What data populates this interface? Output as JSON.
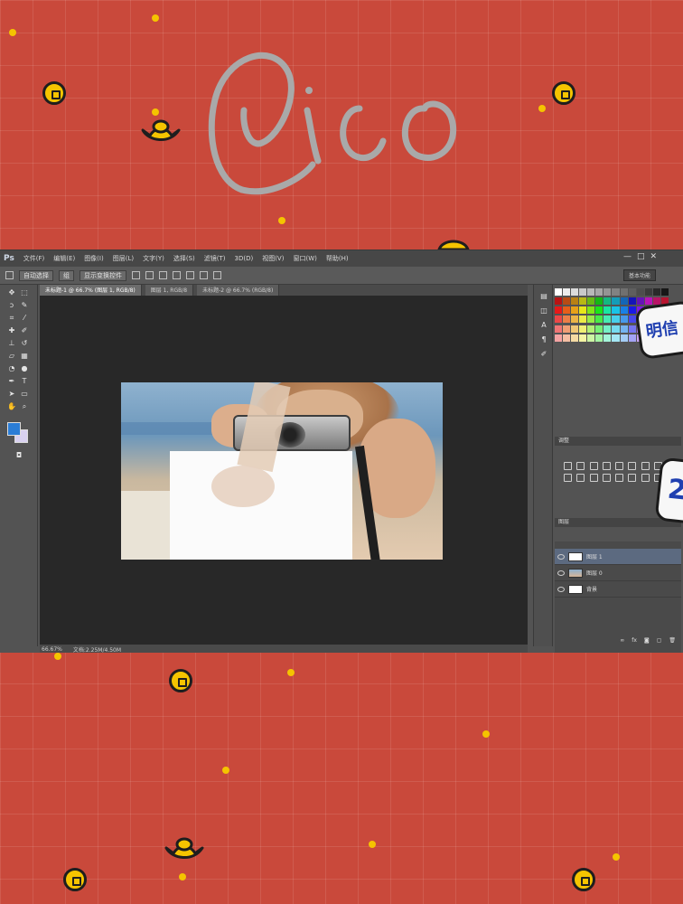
{
  "signature": "Pico",
  "photoshop": {
    "logo": "Ps",
    "menu": [
      "文件(F)",
      "编辑(E)",
      "图像(I)",
      "图层(L)",
      "文字(Y)",
      "选择(S)",
      "滤镜(T)",
      "3D(D)",
      "视图(V)",
      "窗口(W)",
      "帮助(H)"
    ],
    "window_controls": [
      "—",
      "□",
      "✕"
    ],
    "options_bar": {
      "auto_select_label": "自动选择",
      "auto_select_value": "组",
      "show_transform_label": "显示变换控件"
    },
    "workspace": "基本功能",
    "doc_tabs": [
      "未标题-1 @ 66.7% (图层 1, RGB/8)",
      "图层 1, RGB/8",
      "未标题-2 @ 66.7% (RGB/8)"
    ],
    "status": {
      "zoom": "66.67%",
      "doc_size": "文档:2.25M/4.50M"
    },
    "layers": [
      {
        "name": "图层 1",
        "selected": true,
        "thumb": "white"
      },
      {
        "name": "图层 0",
        "selected": false,
        "thumb": "photo"
      },
      {
        "name": "背景",
        "selected": false,
        "thumb": "white"
      }
    ],
    "panel_tabs": {
      "adjustments": "调整",
      "layers": "图层"
    },
    "tools": [
      "move",
      "marquee",
      "lasso",
      "quick-select",
      "crop",
      "eyedropper",
      "healing",
      "brush",
      "clone",
      "history-brush",
      "eraser",
      "gradient",
      "blur",
      "dodge",
      "pen",
      "type",
      "path-select",
      "shape",
      "hand",
      "zoom"
    ]
  },
  "stickers": {
    "top": "明信",
    "bottom": "2"
  },
  "colors": {
    "background": "#c9493b",
    "coin": "#f5c400",
    "signature_stroke": "#a8a8a8"
  }
}
